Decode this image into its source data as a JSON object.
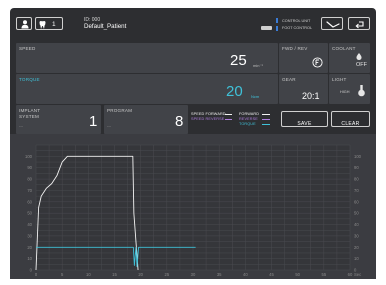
{
  "header": {
    "patient_count": "1",
    "patient_id": "ID: 000",
    "patient_name": "Default_Patient",
    "control_unit_label": "CONTROL UNIT",
    "foot_control_label": "FOOT CONTROL"
  },
  "speed": {
    "label": "SPEED",
    "value": "25",
    "unit": "min⁻¹"
  },
  "torque": {
    "label": "TORQUE",
    "value": "20",
    "unit": "Ncm"
  },
  "fwd_rev": {
    "label": "FWD / REV",
    "icon": "f-circle-icon"
  },
  "coolant": {
    "label": "COOLANT",
    "state": "OFF"
  },
  "gear": {
    "label": "GEAR",
    "value": "20:1"
  },
  "light": {
    "label": "LIGHT",
    "state": "HIGH"
  },
  "implant_system": {
    "label": "IMPLANT SYSTEM",
    "value": "1",
    "sub": "---"
  },
  "program": {
    "label": "PROGRAM",
    "value": "8",
    "sub": "---"
  },
  "legend": {
    "speed_forward": "SPEED FORWARD",
    "speed_reverse": "SPEED REVERSE",
    "forward": "FORWARD",
    "reverse": "REVERSE",
    "torque": "TORQUE"
  },
  "buttons": {
    "save": "SAVE",
    "clear": "CLEAR"
  },
  "colors": {
    "background": "#2d2e31",
    "panel": "#414348",
    "torque_accent": "#3fc1d8",
    "speed_line": "#ffffff",
    "reverse_accent": "#b07fe0"
  },
  "chart_data": {
    "type": "line",
    "x_unit": "Sec",
    "xlim": [
      0,
      60
    ],
    "ylim": [
      0,
      110
    ],
    "x_ticks": [
      "0",
      "5",
      "10",
      "15",
      "20",
      "25",
      "30",
      "35",
      "40",
      "45",
      "50",
      "55",
      "60"
    ],
    "y_ticks": [
      "0",
      "10",
      "20",
      "30",
      "40",
      "50",
      "60",
      "70",
      "80",
      "90",
      "100"
    ],
    "series": [
      {
        "name": "SPEED",
        "color": "#f2f2f2",
        "x": [
          0,
          0.5,
          1,
          2,
          3,
          4,
          5,
          6,
          7,
          18.5,
          18.7,
          19.5
        ],
        "y": [
          0,
          55,
          65,
          72,
          76,
          83,
          95,
          100,
          100,
          100,
          50,
          0
        ]
      },
      {
        "name": "TORQUE",
        "color": "#3fc1d8",
        "x": [
          0,
          18.6,
          18.8,
          19.1,
          19.3,
          19.6,
          30.5
        ],
        "y": [
          20,
          20,
          4,
          20,
          3,
          20,
          20
        ]
      }
    ]
  }
}
